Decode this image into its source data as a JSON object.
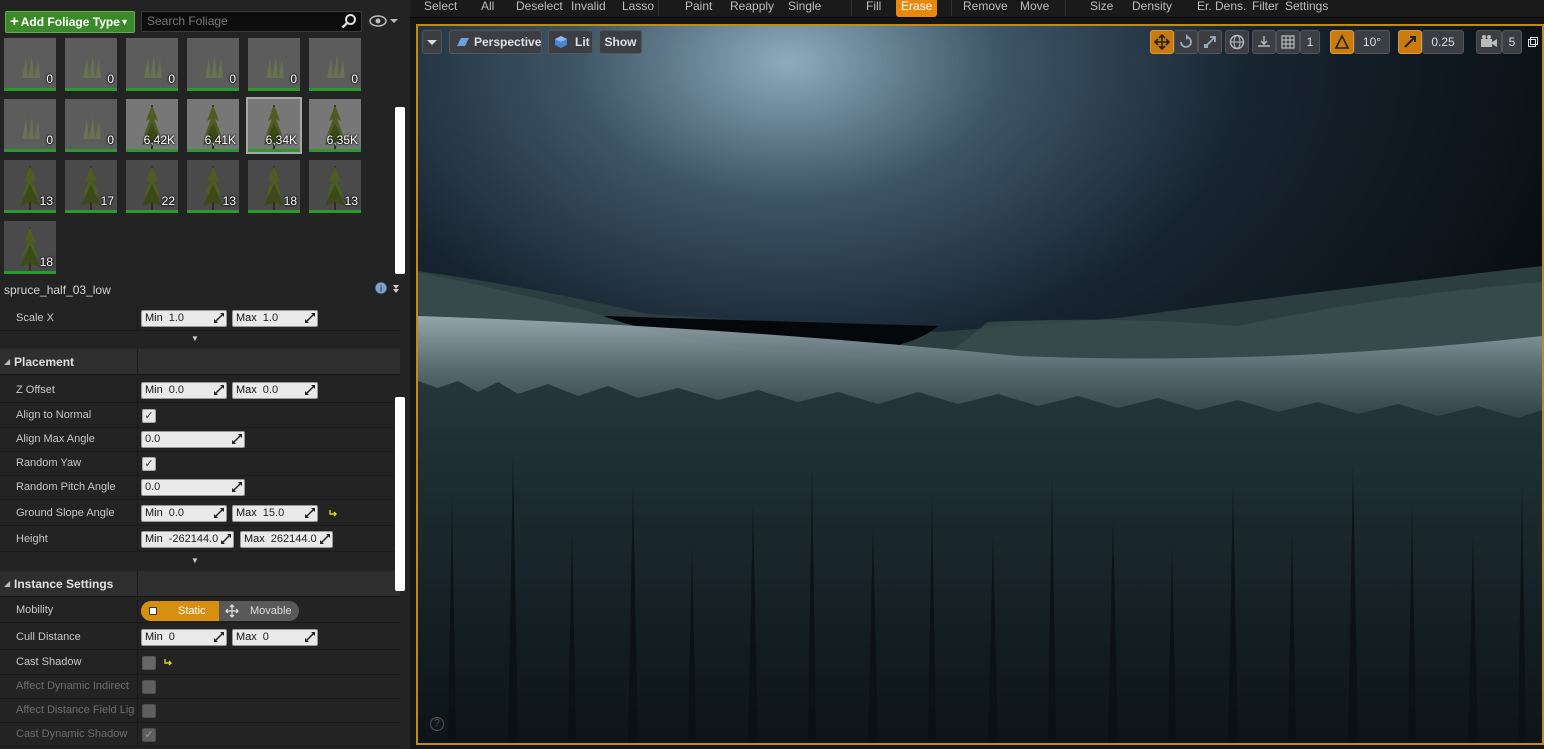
{
  "toolbar": {
    "items": [
      "Select",
      "All",
      "Deselect",
      "Invalid",
      "Lasso",
      "Paint",
      "Reapply",
      "Single",
      "Fill",
      "Erase",
      "Remove",
      "Move",
      "Size",
      "Density",
      "Er. Dens.",
      "Filter",
      "Settings"
    ],
    "active": "Erase"
  },
  "foliage": {
    "add_label": "Add Foliage Type",
    "search_placeholder": "Search Foliage",
    "tiles": [
      "0",
      "0",
      "0",
      "0",
      "0",
      "0",
      "0",
      "0",
      "6,42K",
      "6,41K",
      "6,34K",
      "6,35K",
      "13",
      "17",
      "22",
      "13",
      "18",
      "13",
      "18"
    ],
    "selected_index": 10,
    "selected_name": "spruce_half_03_low"
  },
  "details": {
    "scale_x": {
      "label": "Scale X",
      "min_key": "Min",
      "min": "1.0",
      "max_key": "Max",
      "max": "1.0"
    },
    "placement": {
      "title": "Placement",
      "z_offset": {
        "label": "Z Offset",
        "min": "0.0",
        "max": "0.0"
      },
      "align_to_normal": {
        "label": "Align to Normal"
      },
      "align_max_angle": {
        "label": "Align Max Angle",
        "value": "0.0"
      },
      "random_yaw": {
        "label": "Random Yaw"
      },
      "random_pitch_angle": {
        "label": "Random Pitch Angle",
        "value": "0.0"
      },
      "ground_slope_angle": {
        "label": "Ground Slope Angle",
        "min": "0.0",
        "max": "15.0"
      },
      "height": {
        "label": "Height",
        "min": "-262144.0",
        "max": "262144.0"
      }
    },
    "instance": {
      "title": "Instance Settings",
      "mobility": {
        "label": "Mobility",
        "static": "Static",
        "movable": "Movable"
      },
      "cull_distance": {
        "label": "Cull Distance",
        "min": "0",
        "max": "0"
      },
      "cast_shadow": {
        "label": "Cast Shadow"
      },
      "affect_dynamic_indirect": {
        "label": "Affect Dynamic Indirect"
      },
      "affect_distance_field": {
        "label": "Affect Distance Field Lig"
      },
      "cast_dynamic_shadow": {
        "label": "Cast Dynamic Shadow"
      }
    },
    "min_key": "Min",
    "max_key": "Max"
  },
  "viewport": {
    "perspective": "Perspective",
    "lit": "Lit",
    "show": "Show",
    "grid_size": "1",
    "rotation_snap": "10°",
    "scale_snap": "0.25",
    "camera_speed": "5",
    "help": "?"
  }
}
